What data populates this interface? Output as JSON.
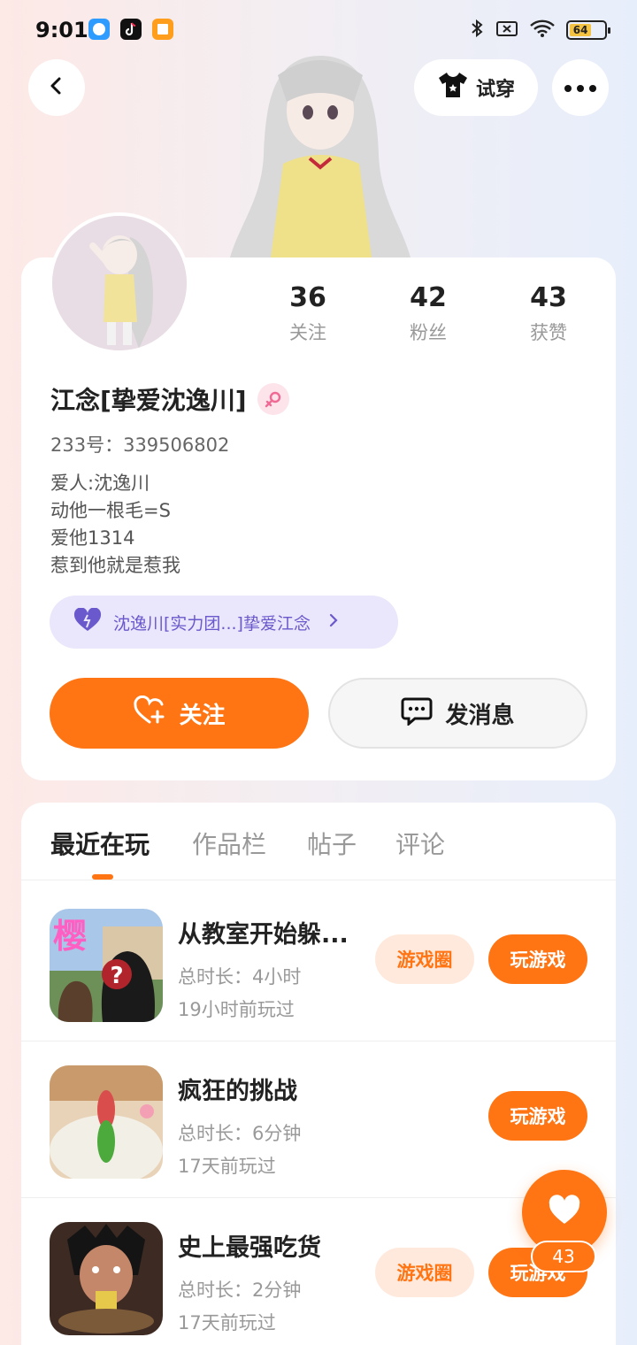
{
  "status_bar": {
    "time": "9:01",
    "battery": "64",
    "icons": [
      "bluetooth-icon",
      "sim-off-icon",
      "wifi-icon",
      "battery-icon"
    ],
    "app_icons": [
      "messenger-app-icon",
      "tiktok-app-icon",
      "reader-app-icon"
    ]
  },
  "header": {
    "back_icon": "chevron-left-icon",
    "try_on_label": "试穿",
    "more_icon": "more-dots-icon"
  },
  "profile": {
    "stats": [
      {
        "value": "36",
        "label": "关注"
      },
      {
        "value": "42",
        "label": "粉丝"
      },
      {
        "value": "43",
        "label": "获赞"
      }
    ],
    "nickname": "江念[挚爱沈逸川]",
    "gender": "female",
    "id_line": "233号：339506802",
    "bio_lines": [
      "爱人:沈逸川",
      "动他一根毛=S",
      "爱他1314",
      "惹到他就是惹我"
    ],
    "couple_label": "沈逸川[实力团...]挚爱江念",
    "follow_label": "关注",
    "message_label": "发消息"
  },
  "tabs": [
    {
      "label": "最近在玩",
      "active": true
    },
    {
      "label": "作品栏",
      "active": false
    },
    {
      "label": "帖子",
      "active": false
    },
    {
      "label": "评论",
      "active": false
    }
  ],
  "games": [
    {
      "title": "从教室开始躲...",
      "duration": "总时长：4小时",
      "last_played": "19小时前玩过",
      "has_circle": true,
      "circle_label": "游戏圈",
      "play_label": "玩游戏"
    },
    {
      "title": "疯狂的挑战",
      "duration": "总时长：6分钟",
      "last_played": "17天前玩过",
      "has_circle": false,
      "circle_label": "",
      "play_label": "玩游戏"
    },
    {
      "title": "史上最强吃货",
      "duration": "总时长：2分钟",
      "last_played": "17天前玩过",
      "has_circle": true,
      "circle_label": "游戏圈",
      "play_label": "玩游戏"
    }
  ],
  "game_icon_text": {
    "sakura": "樱",
    "mystery": "?"
  },
  "like_fab": {
    "count": "43"
  },
  "colors": {
    "accent": "#ff7413",
    "couple": "#6a59cc",
    "gender": "#f06a96"
  }
}
